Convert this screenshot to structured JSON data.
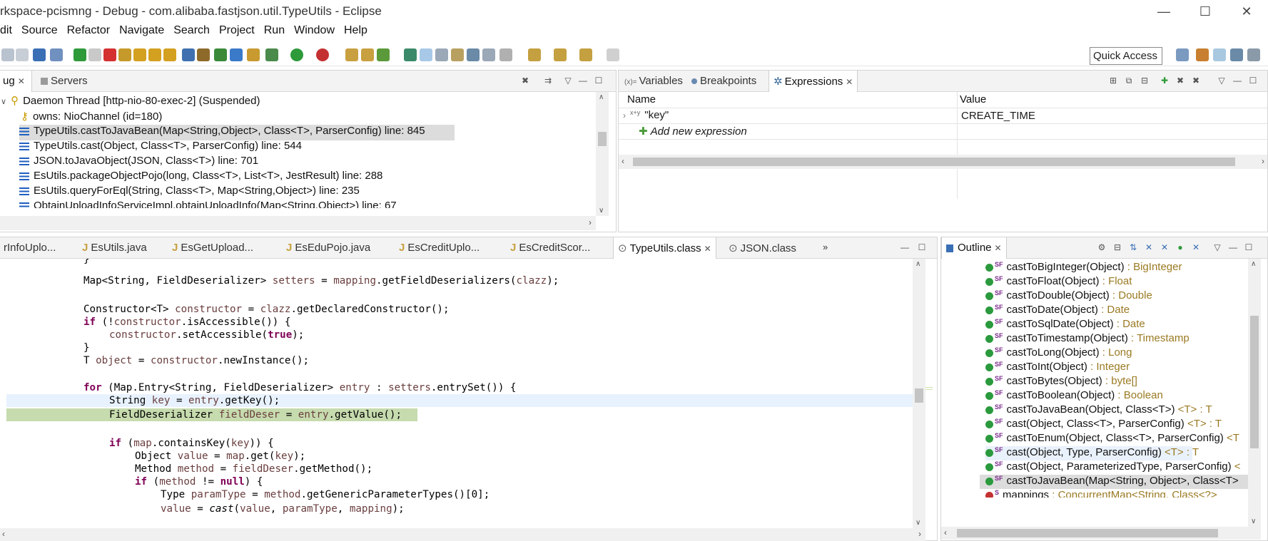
{
  "window": {
    "title": "rkspace-pcismng - Debug - com.alibaba.fastjson.util.TypeUtils - Eclipse",
    "minimize": "—",
    "maximize": "☐",
    "close": "✕"
  },
  "menu": [
    "dit",
    "Source",
    "Refactor",
    "Navigate",
    "Search",
    "Project",
    "Run",
    "Window",
    "Help"
  ],
  "toolbar": {
    "quick_access": "Quick Access"
  },
  "debug_panel": {
    "tabs": [
      {
        "label": "ug",
        "close": "✕"
      },
      {
        "label": "Servers"
      }
    ],
    "rows": [
      {
        "text": "Daemon Thread [http-nio-80-exec-2] (Suspended)",
        "kind": "thread"
      },
      {
        "text": "owns: NioChannel  (id=180)",
        "kind": "owns"
      },
      {
        "text": "TypeUtils.castToJavaBean(Map<String,Object>, Class<T>, ParserConfig) line: 845",
        "kind": "frame",
        "selected": true
      },
      {
        "text": "TypeUtils.cast(Object, Class<T>, ParserConfig) line: 544",
        "kind": "frame"
      },
      {
        "text": "JSON.toJavaObject(JSON, Class<T>) line: 701",
        "kind": "frame"
      },
      {
        "text": "EsUtils.packageObjectPojo(long, Class<T>, List<T>, JestResult) line: 288",
        "kind": "frame"
      },
      {
        "text": "EsUtils.queryForEql(String, Class<T>, Map<String,Object>) line: 235",
        "kind": "frame"
      },
      {
        "text": "ObtainUploadInfoServiceImpl.obtainUploadInfo(Map<String,Object>) line: 67",
        "kind": "frame"
      }
    ]
  },
  "expressions_panel": {
    "tabs": [
      {
        "label": "Variables"
      },
      {
        "label": "Breakpoints"
      },
      {
        "label": "Expressions",
        "close": "✕"
      }
    ],
    "columns": [
      "Name",
      "Value"
    ],
    "rows": [
      {
        "name": "\"key\"",
        "value": "CREATE_TIME"
      }
    ],
    "add_label": "Add new expression"
  },
  "editor": {
    "tabs": [
      {
        "label": "rInfoUplo..."
      },
      {
        "label": "EsUtils.java"
      },
      {
        "label": "EsGetUpload..."
      },
      {
        "label": "EsEduPojo.java"
      },
      {
        "label": "EsCreditUplo..."
      },
      {
        "label": "EsCreditScor..."
      },
      {
        "label": "TypeUtils.class",
        "close": "✕"
      },
      {
        "label": "JSON.class"
      },
      {
        "label": "»"
      }
    ]
  },
  "outline": {
    "tab": {
      "label": "Outline",
      "close": "✕"
    },
    "rows": [
      {
        "name": "castToBigInteger(Object)",
        "type": " : BigInteger"
      },
      {
        "name": "castToFloat(Object)",
        "type": " : Float"
      },
      {
        "name": "castToDouble(Object)",
        "type": " : Double"
      },
      {
        "name": "castToDate(Object)",
        "type": " : Date"
      },
      {
        "name": "castToSqlDate(Object)",
        "type": " : Date"
      },
      {
        "name": "castToTimestamp(Object)",
        "type": " : Timestamp"
      },
      {
        "name": "castToLong(Object)",
        "type": " : Long"
      },
      {
        "name": "castToInt(Object)",
        "type": " : Integer"
      },
      {
        "name": "castToBytes(Object)",
        "type": " : byte[]"
      },
      {
        "name": "castToBoolean(Object)",
        "type": " : Boolean"
      },
      {
        "name": "castToJavaBean(Object, Class<T>)",
        "type": " <T> : T"
      },
      {
        "name": "cast(Object, Class<T>, ParserConfig)",
        "type": " <T> : T"
      },
      {
        "name": "castToEnum(Object, Class<T>, ParserConfig)",
        "type": " <T"
      },
      {
        "name": "cast(Object, Type, ParserConfig)",
        "type": " <T> : T",
        "highlight": true
      },
      {
        "name": "cast(Object, ParameterizedType, ParserConfig)",
        "type": " <"
      },
      {
        "name": "castToJavaBean(Map<String, Object>, Class<T>",
        "type": "",
        "selected": true
      },
      {
        "name": "mappings",
        "type": " : ConcurrentMap<String, Class<?>"
      }
    ]
  }
}
